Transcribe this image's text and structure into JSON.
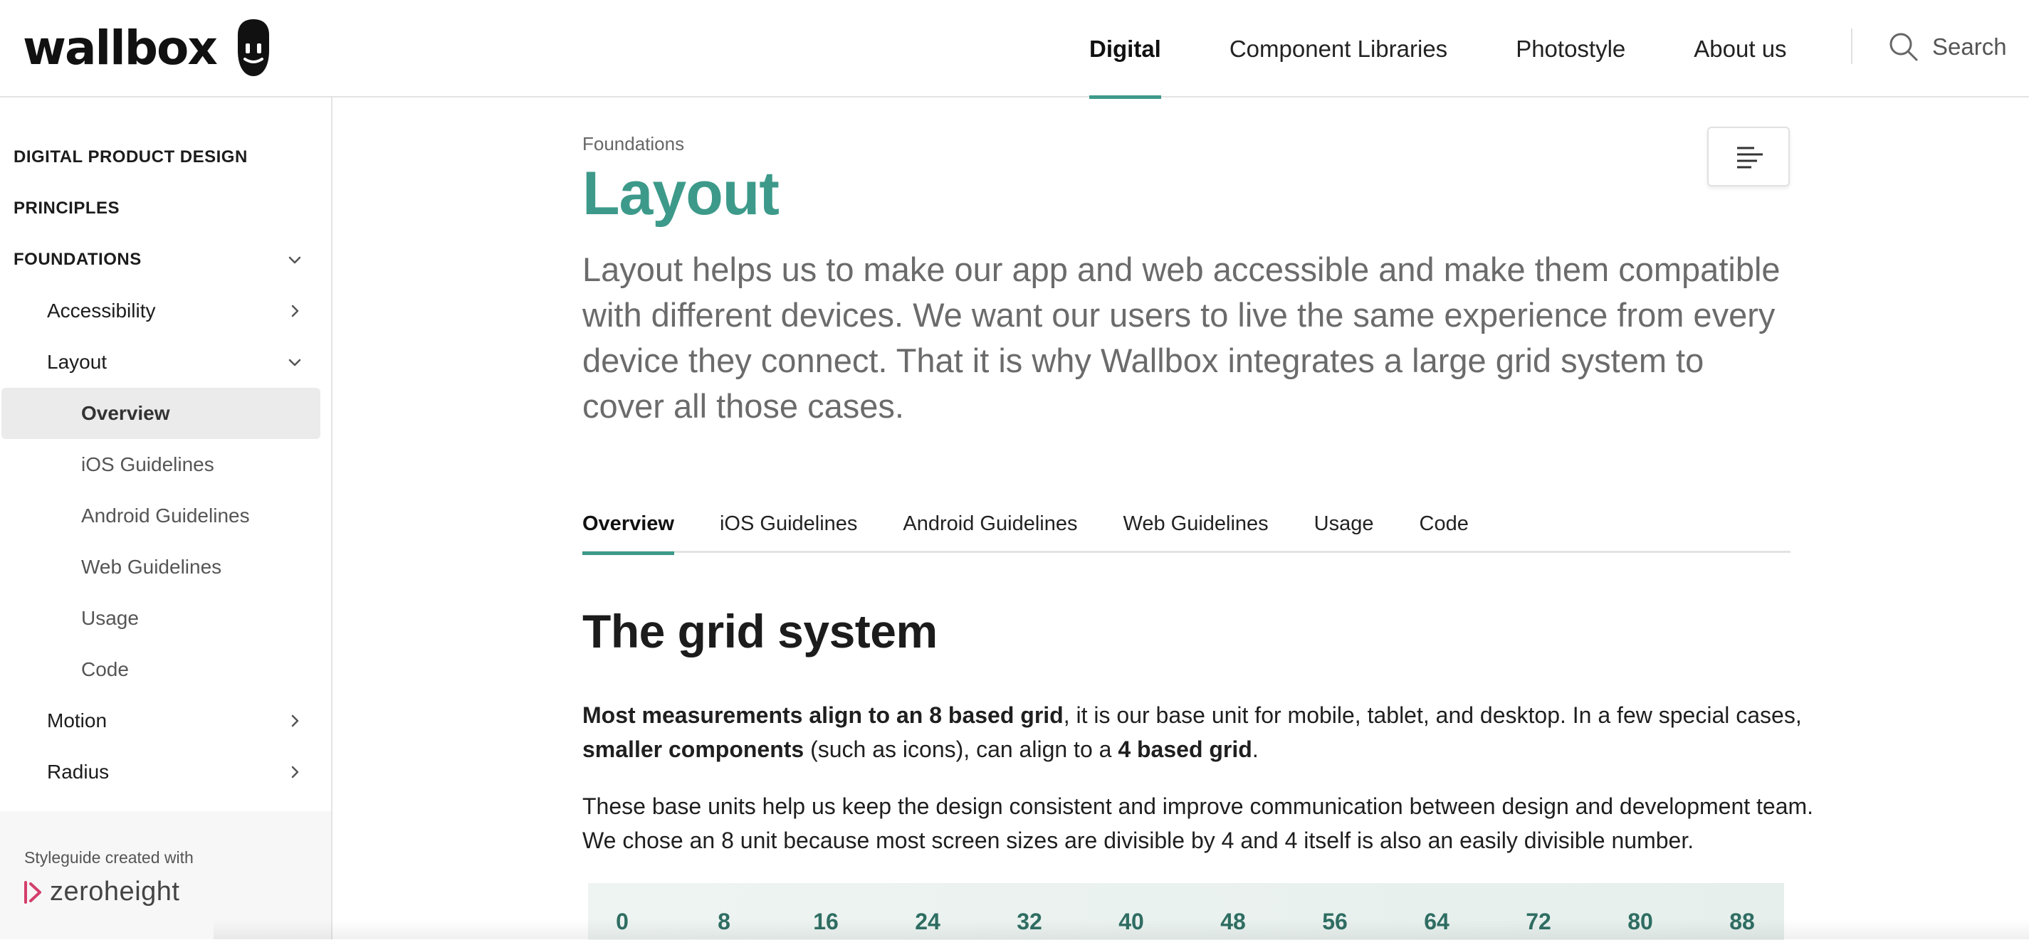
{
  "brand": {
    "name": "wallbox",
    "accent": "#3d9a8a"
  },
  "topnav": {
    "items": [
      "Digital",
      "Component Libraries",
      "Photostyle",
      "About us"
    ],
    "active": "Digital",
    "search_label": "Search"
  },
  "sidebar": {
    "items": [
      {
        "label": "DIGITAL PRODUCT DESIGN",
        "level": 0
      },
      {
        "label": "PRINCIPLES",
        "level": 0
      },
      {
        "label": "FOUNDATIONS",
        "level": 0,
        "expanded": true
      },
      {
        "label": "Accessibility",
        "level": 1,
        "expanded": false
      },
      {
        "label": "Layout",
        "level": 1,
        "expanded": true
      },
      {
        "label": "Overview",
        "level": 2,
        "selected": true
      },
      {
        "label": "iOS Guidelines",
        "level": 2
      },
      {
        "label": "Android Guidelines",
        "level": 2
      },
      {
        "label": "Web Guidelines",
        "level": 2
      },
      {
        "label": "Usage",
        "level": 2
      },
      {
        "label": "Code",
        "level": 2
      },
      {
        "label": "Motion",
        "level": 1,
        "expanded": false
      },
      {
        "label": "Radius",
        "level": 1,
        "expanded": false
      }
    ],
    "footer": {
      "caption": "Styleguide created with",
      "logo_text": "zeroheight"
    }
  },
  "main": {
    "breadcrumb": "Foundations",
    "title": "Layout",
    "intro": "Layout helps us to make our app and web accessible and make them compatible with different devices. We want our users to live the same experience from every device they connect. That it is why Wallbox integrates a large grid system to cover all those cases.",
    "tabs": [
      "Overview",
      "iOS Guidelines",
      "Android Guidelines",
      "Web Guidelines",
      "Usage",
      "Code"
    ],
    "active_tab": "Overview",
    "section_title": "The grid system",
    "para1": {
      "b1": "Most measurements align to an 8 based grid",
      "t1": ", it is our base unit for mobile, tablet, and desktop. In a few special cases, ",
      "b2": "smaller components",
      "t2": " (such as icons), can align to a ",
      "b3": "4 based grid",
      "t3": "."
    },
    "para2": "These base units help us keep the design consistent and improve communication between design and development team. We chose an 8 unit because most screen sizes are divisible by 4 and 4 itself is also an easily divisible number.",
    "grid_values": [
      "0",
      "8",
      "16",
      "24",
      "32",
      "40",
      "48",
      "56",
      "64",
      "72",
      "80",
      "88"
    ]
  }
}
